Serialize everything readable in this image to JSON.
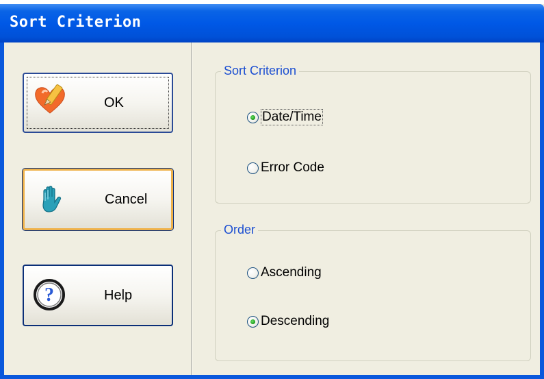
{
  "window": {
    "title": "Sort Criterion"
  },
  "buttons": {
    "ok": {
      "label": "OK",
      "icon": "heart-pencil-icon"
    },
    "cancel": {
      "label": "Cancel",
      "icon": "hand-stop-icon"
    },
    "help": {
      "label": "Help",
      "icon": "question-icon"
    }
  },
  "sort_group": {
    "title": "Sort Criterion",
    "options": [
      {
        "label": "Date/Time",
        "selected": true
      },
      {
        "label": "Error Code",
        "selected": false
      }
    ]
  },
  "order_group": {
    "title": "Order",
    "options": [
      {
        "label": "Ascending",
        "selected": false
      },
      {
        "label": "Descending",
        "selected": true
      }
    ]
  },
  "colors": {
    "titlebar": "#0058e6",
    "group_title": "#1b4ed1",
    "selected_dot": "#21a121",
    "cancel_focus": "#efb24a"
  }
}
